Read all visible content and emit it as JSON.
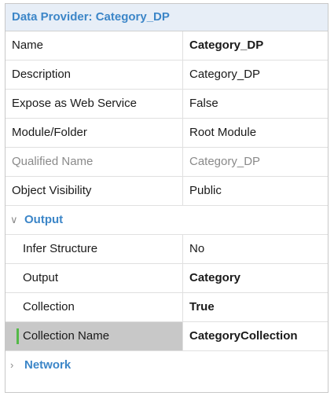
{
  "panel": {
    "title": "Data Provider: Category_DP"
  },
  "properties": [
    {
      "name": "Name",
      "value": "Category_DP",
      "value_bold": true
    },
    {
      "name": "Description",
      "value": "Category_DP"
    },
    {
      "name": "Expose as Web Service",
      "value": "False"
    },
    {
      "name": "Module/Folder",
      "value": "Root Module"
    },
    {
      "name": "Qualified Name",
      "value": "Category_DP",
      "greyed": true
    },
    {
      "name": "Object Visibility",
      "value": "Public"
    }
  ],
  "output_section": {
    "label": "Output",
    "expanded": true,
    "chevron_icon": "chevron-down-icon",
    "rows": [
      {
        "name": "Infer Structure",
        "value": "No"
      },
      {
        "name": "Output",
        "value": "Category",
        "value_bold": true
      },
      {
        "name": "Collection",
        "value": "True",
        "value_bold": true
      },
      {
        "name": "Collection Name",
        "value": "CategoryCollection",
        "value_bold": true,
        "selected": true
      }
    ]
  },
  "network_section": {
    "label": "Network",
    "expanded": false,
    "chevron_icon": "chevron-right-icon"
  },
  "colors": {
    "header_text": "#3c86c8",
    "header_bg": "#e7eef7",
    "selected_bg": "#c8c8c8",
    "selected_marker": "#54b948"
  }
}
